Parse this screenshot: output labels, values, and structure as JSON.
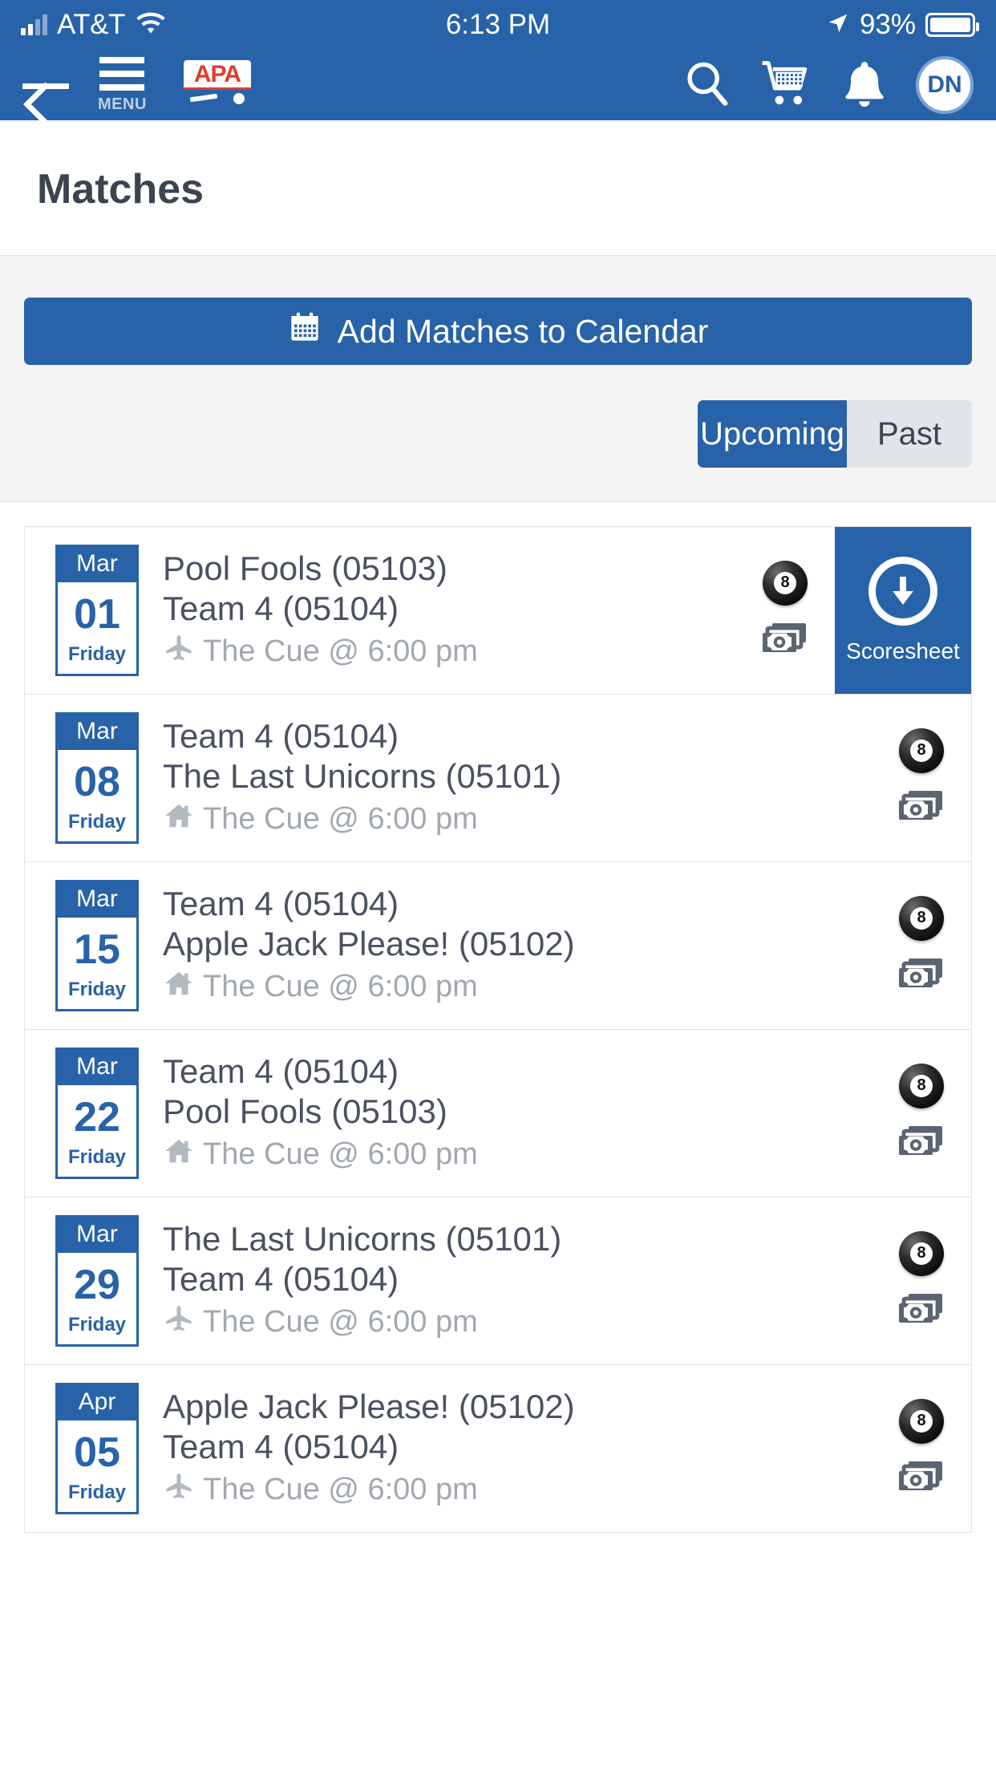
{
  "status_bar": {
    "carrier": "AT&T",
    "time": "6:13 PM",
    "battery_pct": "93%",
    "signal_icon": "signal-bars-icon",
    "wifi_icon": "wifi-icon",
    "location_icon": "location-arrow-icon",
    "battery_icon": "battery-icon"
  },
  "navbar": {
    "back_icon": "back-arrow-icon",
    "menu_label": "MENU",
    "menu_icon": "hamburger-menu-icon",
    "logo_text": "APA",
    "search_icon": "search-icon",
    "cart_icon": "shopping-cart-icon",
    "bell_icon": "bell-notification-icon",
    "avatar_initials": "DN"
  },
  "page": {
    "title": "Matches"
  },
  "toolbar": {
    "calendar_button_label": "Add Matches to Calendar",
    "calendar_icon": "calendar-icon",
    "tabs": [
      {
        "label": "Upcoming",
        "active": true
      },
      {
        "label": "Past",
        "active": false
      }
    ]
  },
  "colors": {
    "brand_blue": "#2862a8",
    "logo_red": "#e23b32",
    "text_dark": "#4a5160",
    "text_muted": "#a2a8b0",
    "panel_gray": "#f4f4f4",
    "tab_inactive": "#e1e5e9"
  },
  "matches": [
    {
      "month": "Mar",
      "day": "01",
      "weekday": "Friday",
      "team_home": "Pool Fools (05103)",
      "team_away": "Team 4 (05104)",
      "venue": "The Cue @ 6:00 pm",
      "location_icon": "airplane-icon",
      "game_icon": "eight-ball-icon",
      "game_number": "8",
      "money_icon": "cash-money-icon",
      "scoresheet_label": "Scoresheet",
      "scoresheet_icon": "download-circle-arrow-icon",
      "has_scoresheet": true
    },
    {
      "month": "Mar",
      "day": "08",
      "weekday": "Friday",
      "team_home": "Team 4 (05104)",
      "team_away": "The Last Unicorns (05101)",
      "venue": "The Cue @ 6:00 pm",
      "location_icon": "home-icon",
      "game_icon": "eight-ball-icon",
      "game_number": "8",
      "money_icon": "cash-money-icon",
      "has_scoresheet": false
    },
    {
      "month": "Mar",
      "day": "15",
      "weekday": "Friday",
      "team_home": "Team 4 (05104)",
      "team_away": "Apple Jack Please! (05102)",
      "venue": "The Cue @ 6:00 pm",
      "location_icon": "home-icon",
      "game_icon": "eight-ball-icon",
      "game_number": "8",
      "money_icon": "cash-money-icon",
      "has_scoresheet": false
    },
    {
      "month": "Mar",
      "day": "22",
      "weekday": "Friday",
      "team_home": "Team 4 (05104)",
      "team_away": "Pool Fools (05103)",
      "venue": "The Cue @ 6:00 pm",
      "location_icon": "home-icon",
      "game_icon": "eight-ball-icon",
      "game_number": "8",
      "money_icon": "cash-money-icon",
      "has_scoresheet": false
    },
    {
      "month": "Mar",
      "day": "29",
      "weekday": "Friday",
      "team_home": "The Last Unicorns (05101)",
      "team_away": "Team 4 (05104)",
      "venue": "The Cue @ 6:00 pm",
      "location_icon": "airplane-icon",
      "game_icon": "eight-ball-icon",
      "game_number": "8",
      "money_icon": "cash-money-icon",
      "has_scoresheet": false
    },
    {
      "month": "Apr",
      "day": "05",
      "weekday": "Friday",
      "team_home": "Apple Jack Please! (05102)",
      "team_away": "Team 4 (05104)",
      "venue": "The Cue @ 6:00 pm",
      "location_icon": "airplane-icon",
      "game_icon": "eight-ball-icon",
      "game_number": "8",
      "money_icon": "cash-money-icon",
      "has_scoresheet": false
    }
  ]
}
